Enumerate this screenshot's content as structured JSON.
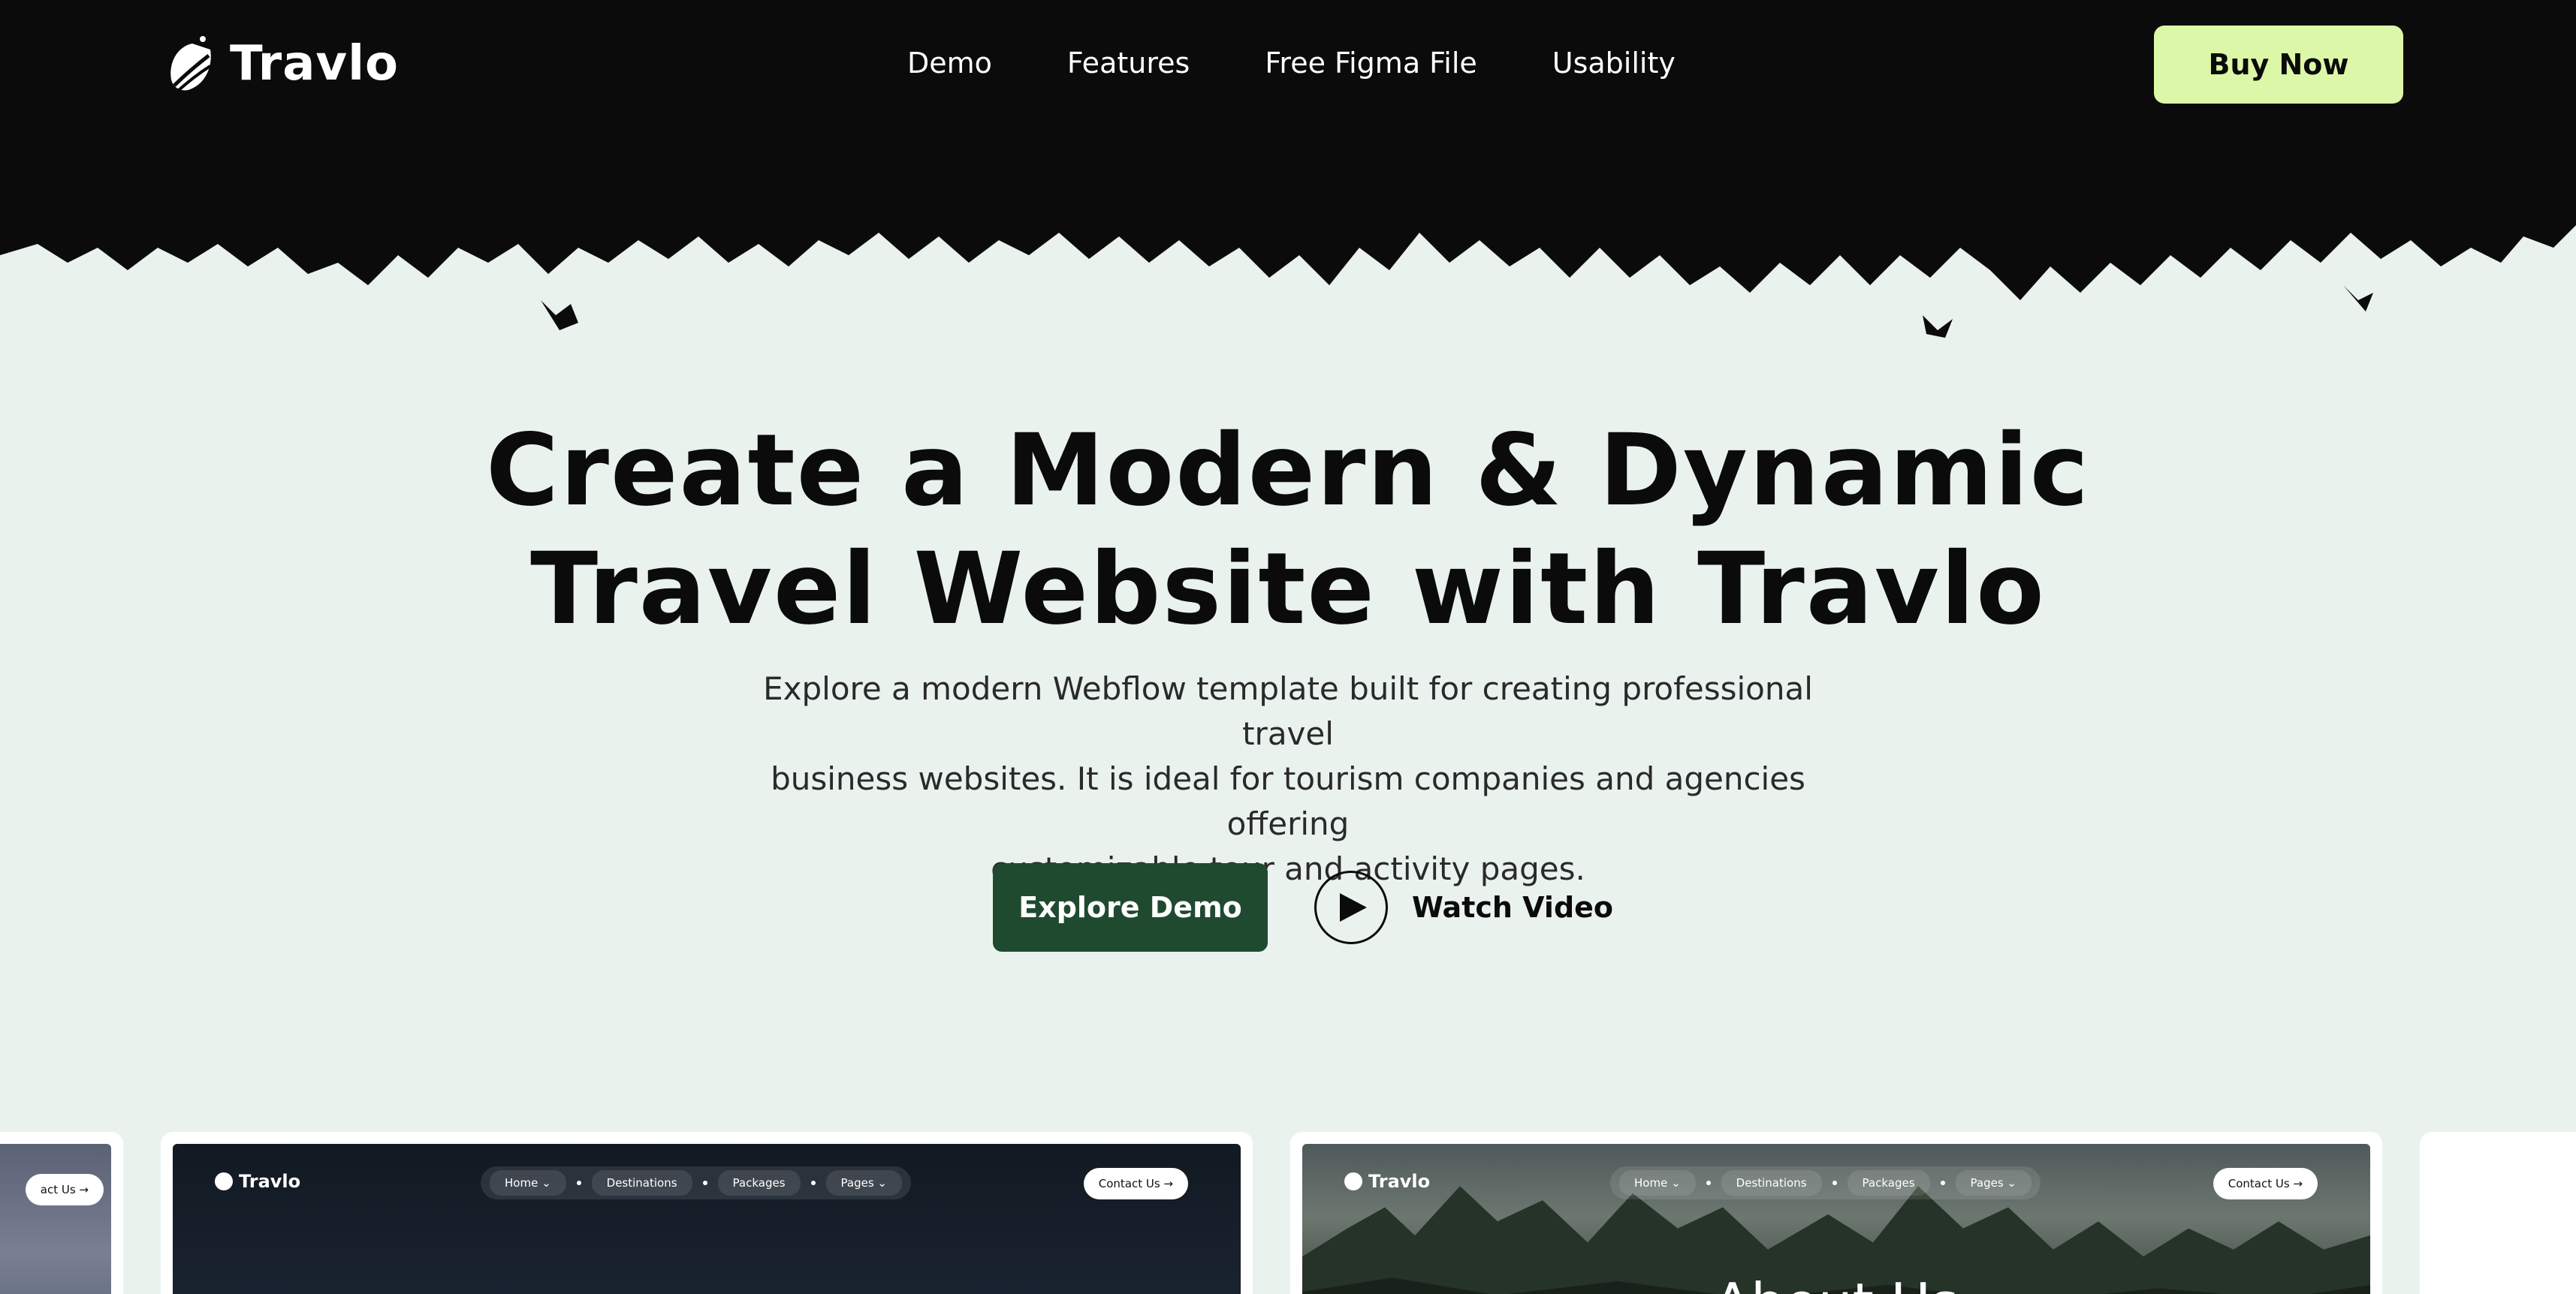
{
  "header": {
    "brand": "Travlo",
    "nav": [
      "Demo",
      "Features",
      "Free Figma File",
      "Usability"
    ],
    "buy_label": "Buy Now"
  },
  "hero": {
    "title_line1": "Create a Modern & Dynamic",
    "title_line2": "Travel Website with Travlo",
    "subtitle_line1": "Explore a modern Webflow template built for creating professional travel",
    "subtitle_line2": "business websites. It is ideal for tourism companies and agencies offering",
    "subtitle_line3": "customizable tour and activity pages.",
    "explore_label": "Explore Demo",
    "watch_label": "Watch Video"
  },
  "previews": {
    "card_left_partial": {
      "contact_label": "act Us →"
    },
    "card_1": {
      "brand": "Travlo",
      "menu": [
        "Home ⌄",
        "Destinations",
        "Packages",
        "Pages ⌄"
      ],
      "contact_label": "Contact Us →"
    },
    "card_2": {
      "brand": "Travlo",
      "menu": [
        "Home ⌄",
        "Destinations",
        "Packages",
        "Pages ⌄"
      ],
      "contact_label": "Contact Us →",
      "heading": "About Us"
    }
  },
  "colors": {
    "header_bg": "#0b0b0b",
    "page_bg": "#eaf2ee",
    "accent_buy": "#dcf7a8",
    "accent_explore": "#1f4a30"
  }
}
